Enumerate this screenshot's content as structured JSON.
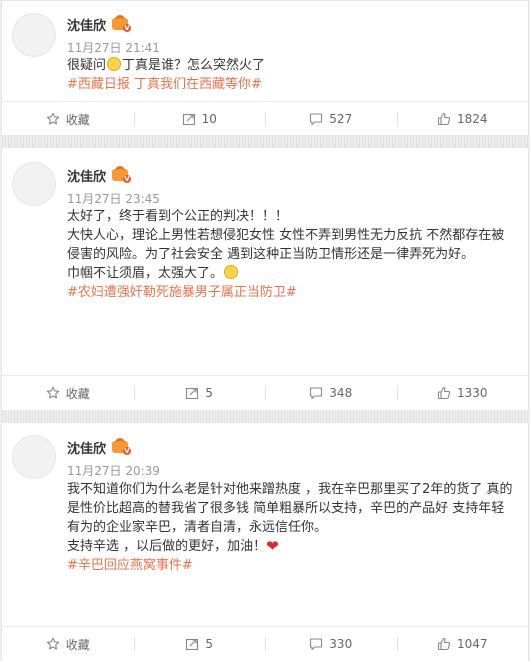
{
  "posts": [
    {
      "author": "沈佳欣",
      "time": "11月27日 21:41",
      "text_before": "很疑问",
      "text_after": "丁真是谁？怎么突然火了",
      "tags": "#西藏日报 丁真我们在西藏等你#",
      "toolbar": {
        "favorite": "收藏",
        "repost": "10",
        "comment": "527",
        "like": "1824"
      }
    },
    {
      "author": "沈佳欣",
      "time": "11月27日 23:45",
      "line1": "太好了，终于看到个公正的判决！！！",
      "line2": "大快人心，理论上男性若想侵犯女性 女性不弄到男性无力反抗 不然都存在被侵害的风险。为了社会安全 遇到这种正当防卫情形还是一律弄死为好。",
      "line3": "巾帼不让须眉，太强大了。",
      "tags": "#农妇遭强奸勒死施暴男子属正当防卫#",
      "toolbar": {
        "favorite": "收藏",
        "repost": "5",
        "comment": "348",
        "like": "1330"
      }
    },
    {
      "author": "沈佳欣",
      "time": "11月27日 20:39",
      "line1": "我不知道你们为什么老是针对他来蹭热度 ，我在辛巴那里买了2年的货了 真的是性价比超高的替我省了很多钱 简单粗暴所以支持，辛巴的产品好 支持年轻有为的企业家辛巴，清者自清，永远信任你。",
      "line2": "支持辛选 ，以后做的更好，加油！",
      "tags": "#辛巴回应燕窝事件#",
      "toolbar": {
        "favorite": "收藏",
        "repost": "5",
        "comment": "330",
        "like": "1047"
      }
    }
  ]
}
